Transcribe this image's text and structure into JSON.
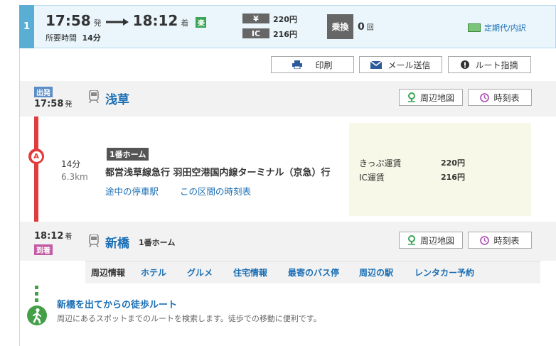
{
  "route": {
    "index": "1",
    "depart_time": "17:58",
    "depart_suffix": "発",
    "arrive_time": "18:12",
    "arrive_suffix": "着",
    "fast_badge": "楽",
    "duration_label": "所要時間",
    "duration_value": "14分",
    "yen_label": "¥",
    "fare_ticket": "220円",
    "ic_label": "IC",
    "fare_ic": "216円",
    "transfer_label": "乗換",
    "transfer_count": "0",
    "transfer_unit": "回",
    "commuter_link": "定期代/内訳"
  },
  "toolbar": {
    "print": "印刷",
    "mail": "メール送信",
    "report": "ルート指摘"
  },
  "departure": {
    "tag": "出発",
    "time": "17:58",
    "suffix": "発",
    "station": "浅草",
    "map_button": "周辺地図",
    "timetable_button": "時刻表"
  },
  "segment": {
    "line_letter": "A",
    "minutes": "14分",
    "distance": "6.3km",
    "platform": "1番ホーム",
    "line_name": "都営浅草線急行 羽田空港国内線ターミナル（京急）行",
    "stops_link": "途中の停車駅",
    "timetable_link": "この区間の時刻表",
    "fare_ticket_label": "きっぷ運賃",
    "fare_ticket": "220円",
    "fare_ic_label": "IC運賃",
    "fare_ic": "216円"
  },
  "arrival": {
    "time": "18:12",
    "suffix": "着",
    "tag": "到着",
    "station": "新橋",
    "platform": "1番ホーム",
    "map_button": "周辺地図",
    "timetable_button": "時刻表"
  },
  "nearby": {
    "label": "周辺情報",
    "items": [
      "ホテル",
      "グルメ",
      "住宅情報",
      "最寄のバス停",
      "周辺の駅",
      "レンタカー予約"
    ]
  },
  "walk": {
    "title": "新橋を出てからの徒歩ルート",
    "desc": "周辺にあるスポットまでのルートを検索します。徒歩での移動に便利です。"
  },
  "colors": {
    "line_red": "#e23b3b",
    "accent_blue": "#1a6eb4",
    "depart_tag": "#5b8ec7",
    "arrive_tag": "#c45ba4",
    "walk_green": "#43a047"
  }
}
